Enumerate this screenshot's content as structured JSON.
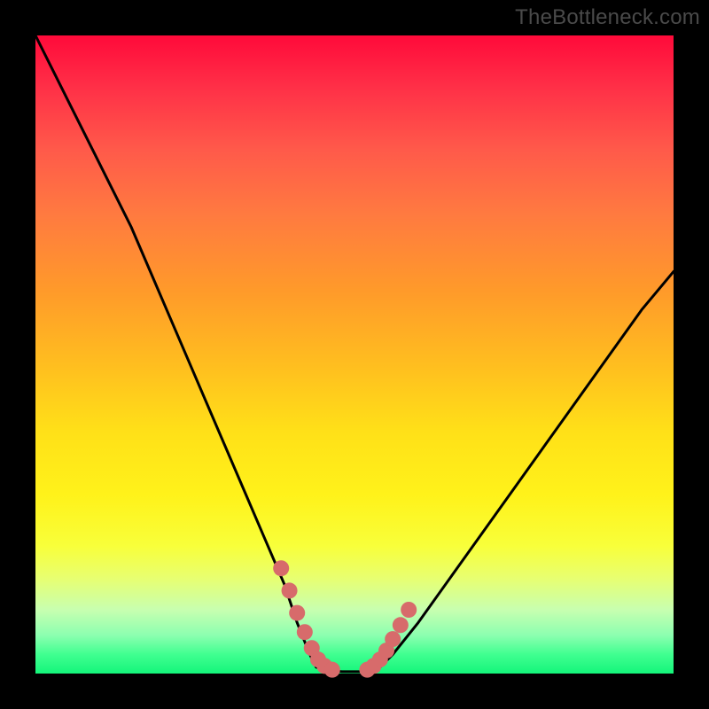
{
  "watermark": "TheBottleneck.com",
  "chart_data": {
    "type": "line",
    "title": "",
    "xlabel": "",
    "ylabel": "",
    "xlim": [
      0,
      100
    ],
    "ylim": [
      0,
      100
    ],
    "grid": false,
    "legend": false,
    "background_gradient": {
      "direction": "vertical",
      "stops": [
        {
          "pos": 0.0,
          "color": "#ff0a3a"
        },
        {
          "pos": 0.5,
          "color": "#ffbf1f"
        },
        {
          "pos": 0.8,
          "color": "#f8ff3a"
        },
        {
          "pos": 1.0,
          "color": "#14f57a"
        }
      ]
    },
    "series": [
      {
        "name": "curve-left",
        "color": "#000000",
        "stroke_width": 3,
        "x": [
          0,
          3,
          6,
          9,
          12,
          15,
          18,
          21,
          24,
          27,
          30,
          33,
          36,
          39,
          41,
          43,
          44
        ],
        "y": [
          100,
          94,
          88,
          82,
          76,
          70,
          63,
          56,
          49,
          42,
          35,
          28,
          21,
          14,
          8,
          3,
          1
        ]
      },
      {
        "name": "valley-floor",
        "color": "#000000",
        "stroke_width": 3,
        "x": [
          44,
          46,
          48,
          51,
          53,
          54
        ],
        "y": [
          1,
          0.5,
          0.3,
          0.3,
          0.5,
          1
        ]
      },
      {
        "name": "curve-right",
        "color": "#000000",
        "stroke_width": 3,
        "x": [
          54,
          56,
          60,
          65,
          70,
          75,
          80,
          85,
          90,
          95,
          100
        ],
        "y": [
          1,
          3,
          8,
          15,
          22,
          29,
          36,
          43,
          50,
          57,
          63
        ]
      },
      {
        "name": "markers-left",
        "type": "scatter",
        "color": "#d76b6b",
        "marker_size": 9,
        "x": [
          38.5,
          39.8,
          41.0,
          42.2,
          43.3,
          44.3,
          45.3,
          46.5
        ],
        "y": [
          16.5,
          13.0,
          9.5,
          6.5,
          4.0,
          2.2,
          1.2,
          0.6
        ]
      },
      {
        "name": "markers-right",
        "type": "scatter",
        "color": "#d76b6b",
        "marker_size": 9,
        "x": [
          52.0,
          53.0,
          54.0,
          55.0,
          56.0,
          57.2,
          58.5
        ],
        "y": [
          0.6,
          1.2,
          2.2,
          3.6,
          5.4,
          7.6,
          10.0
        ]
      }
    ]
  }
}
